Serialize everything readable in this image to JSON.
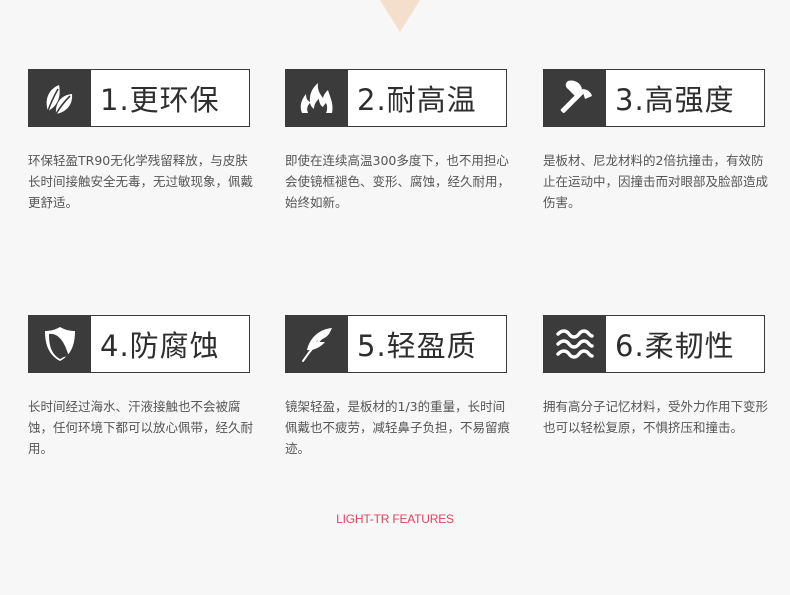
{
  "features": [
    {
      "title": "1.更环保",
      "icon": "leaf-icon",
      "desc": "环保轻盈TR90无化学残留释放，与皮肤长时间接触安全无毒，无过敏现象，佩戴更舒适。"
    },
    {
      "title": "2.耐高温",
      "icon": "flame-icon",
      "desc": "即使在连续高温300多度下，也不用担心会使镜框褪色、变形、腐蚀，经久耐用，始终如新。"
    },
    {
      "title": "3.高强度",
      "icon": "axe-icon",
      "desc": "是板材、尼龙材料的2倍抗撞击，有效防止在运动中，因撞击而对眼部及脸部造成伤害。"
    },
    {
      "title": "4.防腐蚀",
      "icon": "shield-icon",
      "desc": "长时间经过海水、汗液接触也不会被腐蚀，任何环境下都可以放心佩带，经久耐用。"
    },
    {
      "title": "5.轻盈质",
      "icon": "feather-icon",
      "desc": "镜架轻盈，是板材的1/3的重量，长时间佩戴也不疲劳，减轻鼻子负担，不易留痕迹。"
    },
    {
      "title": "6.柔韧性",
      "icon": "waves-icon",
      "desc": "拥有高分子记忆材料，受外力作用下变形也可以轻松复原，不惧挤压和撞击。"
    }
  ],
  "footer": "LIGHT-TR FEATURES",
  "colors": {
    "icon_bg": "#3b3b3b",
    "footer": "#e0435f",
    "notch": "#f3dfcb"
  }
}
